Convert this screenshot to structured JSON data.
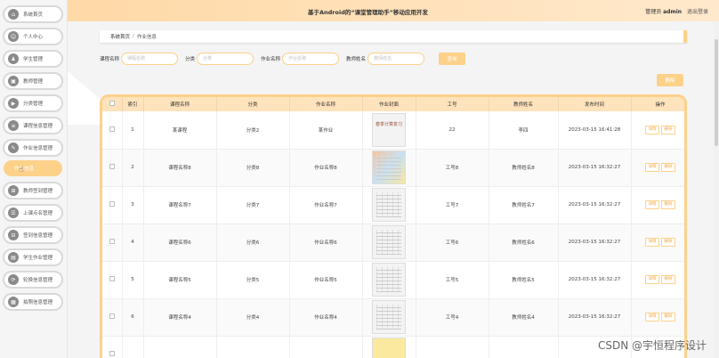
{
  "topbar": {
    "title": "基于Android的“课堂管理助手”移动应用开发",
    "user_prefix": "管理员",
    "user_name": "admin",
    "logout": "退出登录"
  },
  "sidebar": {
    "items": [
      {
        "label": "系统首页",
        "icon": "home-icon"
      },
      {
        "label": "个人中心",
        "icon": "user-icon"
      },
      {
        "label": "学生管理",
        "icon": "student-icon"
      },
      {
        "label": "教师管理",
        "icon": "teacher-icon"
      },
      {
        "label": "分类管理",
        "icon": "category-icon"
      },
      {
        "label": "课程信息管理",
        "icon": "course-icon"
      },
      {
        "label": "作业信息管理",
        "icon": "homework-icon"
      }
    ],
    "sub_item": "作业信息",
    "items_after": [
      {
        "label": "教师签到管理",
        "icon": "signin-icon"
      },
      {
        "label": "上课点名管理",
        "icon": "rollcall-icon"
      },
      {
        "label": "签到信息管理",
        "icon": "checkin-icon"
      },
      {
        "label": "学生作业管理",
        "icon": "student-homework-icon"
      },
      {
        "label": "轮换信息管理",
        "icon": "rotation-icon"
      },
      {
        "label": "拍照信息管理",
        "icon": "photo-icon"
      }
    ]
  },
  "breadcrumb": {
    "home": "系统首页",
    "sep": "/",
    "current": "作业信息"
  },
  "search": {
    "course_label": "课程名称",
    "course_placeholder": "课程名称",
    "category_label": "分类",
    "category_placeholder": "分类",
    "homework_label": "作业名称",
    "homework_placeholder": "作业名称",
    "teacher_label": "教师姓名",
    "teacher_placeholder": "教师姓名",
    "search_button": "查询"
  },
  "delete_button": "删除",
  "table": {
    "headers": [
      "",
      "索引",
      "课程名称",
      "分类",
      "作业名称",
      "作业封面",
      "工号",
      "教师姓名",
      "发布时间",
      "操作"
    ],
    "detail_label": "详情",
    "delete_label": "删除",
    "rows": [
      {
        "index": "1",
        "course": "某课程",
        "category": "分类2",
        "homework": "某作业",
        "cover": "handwritten",
        "cover_text": "春季计算复习",
        "job_no": "22",
        "teacher": "李四",
        "time": "2023-03-15 16:41:28"
      },
      {
        "index": "2",
        "course": "课程名称8",
        "category": "分类8",
        "homework": "作业名称8",
        "cover": "colorful",
        "cover_text": "",
        "job_no": "工号8",
        "teacher": "教师姓名8",
        "time": "2023-03-15 16:32:27"
      },
      {
        "index": "3",
        "course": "课程名称7",
        "category": "分类7",
        "homework": "作业名称7",
        "cover": "grid",
        "cover_text": "",
        "job_no": "工号7",
        "teacher": "教师姓名7",
        "time": "2023-03-15 16:32:27"
      },
      {
        "index": "4",
        "course": "课程名称6",
        "category": "分类6",
        "homework": "作业名称6",
        "cover": "grid",
        "cover_text": "",
        "job_no": "工号6",
        "teacher": "教师姓名6",
        "time": "2023-03-15 16:32:27"
      },
      {
        "index": "5",
        "course": "课程名称5",
        "category": "分类5",
        "homework": "作业名称5",
        "cover": "grid",
        "cover_text": "",
        "job_no": "工号5",
        "teacher": "教师姓名5",
        "time": "2023-03-15 16:32:27"
      },
      {
        "index": "6",
        "course": "课程名称4",
        "category": "分类4",
        "homework": "作业名称4",
        "cover": "grid",
        "cover_text": "",
        "job_no": "工号4",
        "teacher": "教师姓名4",
        "time": "2023-03-15 16:32:27"
      },
      {
        "index": "",
        "course": "",
        "category": "",
        "homework": "",
        "cover": "yellow",
        "cover_text": "",
        "job_no": "",
        "teacher": "",
        "time": ""
      }
    ]
  },
  "watermark": "CSDN @宇恒程序设计"
}
